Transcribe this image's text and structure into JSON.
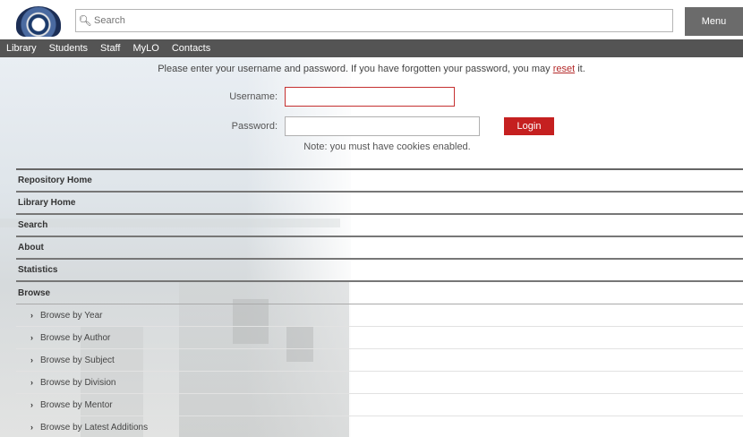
{
  "header": {
    "search_placeholder": "Search",
    "menu_label": "Menu"
  },
  "nav": {
    "items": [
      "Library",
      "Students",
      "Staff",
      "MyLO",
      "Contacts"
    ]
  },
  "login": {
    "intro_text": "Please enter your username and password. If you have forgotten your password, you may ",
    "reset_link": "reset",
    "intro_suffix": " it.",
    "username_label": "Username:",
    "password_label": "Password:",
    "username_value": "",
    "password_value": "",
    "login_button": "Login",
    "note": "Note: you must have cookies enabled."
  },
  "menu": {
    "items": [
      "Repository Home",
      "Library Home",
      "Search",
      "About",
      "Statistics",
      "Browse"
    ],
    "browse_items": [
      "Browse by Year",
      "Browse by Author",
      "Browse by Subject",
      "Browse by Division",
      "Browse by Mentor",
      "Browse by Latest Additions"
    ]
  },
  "colors": {
    "accent": "#c52020",
    "navbar": "#545454",
    "menu_button": "#6b6b6b"
  },
  "icons": {
    "search": "search-icon",
    "chevron": "chevron-right-icon"
  }
}
